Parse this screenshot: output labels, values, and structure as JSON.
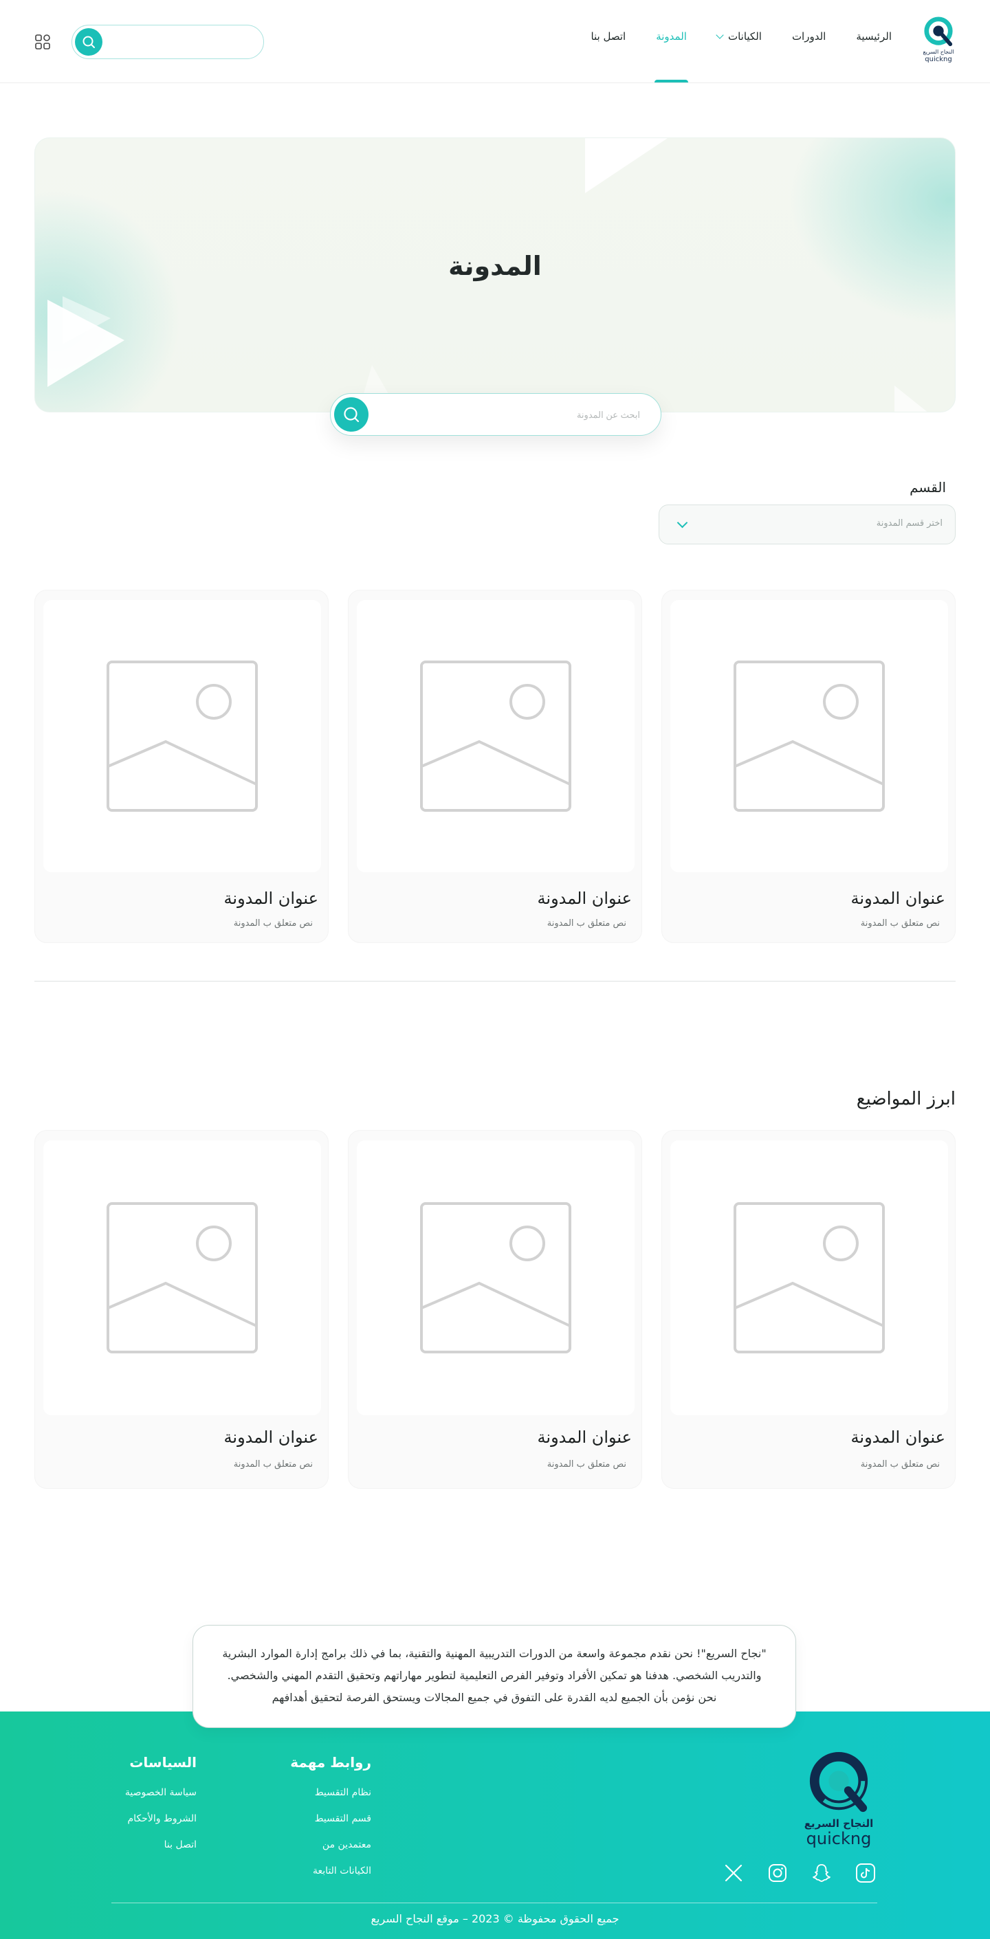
{
  "header": {
    "logo": {
      "ar": "النجاح السريع",
      "en": "quickng"
    },
    "nav": [
      {
        "label": "الرئيسية",
        "active": false,
        "dropdown": false
      },
      {
        "label": "الدورات",
        "active": false,
        "dropdown": false
      },
      {
        "label": "الكيانات",
        "active": false,
        "dropdown": true
      },
      {
        "label": "المدونة",
        "active": true,
        "dropdown": false
      },
      {
        "label": "اتصل بنا",
        "active": false,
        "dropdown": false
      }
    ],
    "search": {
      "placeholder": "",
      "value": ""
    }
  },
  "hero": {
    "title": "المدونة",
    "search_placeholder": "ابحث عن المدونة"
  },
  "filter": {
    "label": "القسم",
    "select_value": "اختر قسم المدونة"
  },
  "blog_cards": [
    {
      "title": "عنوان المدونة",
      "desc": "نص متعلق ب المدونة"
    },
    {
      "title": "عنوان المدونة",
      "desc": "نص متعلق ب المدونة"
    },
    {
      "title": "عنوان المدونة",
      "desc": "نص متعلق ب المدونة"
    }
  ],
  "top_topics": {
    "title": "ابرز المواضيع",
    "cards": [
      {
        "title": "عنوان المدونة",
        "desc": "نص متعلق ب المدونة"
      },
      {
        "title": "عنوان المدونة",
        "desc": "نص متعلق ب المدونة"
      },
      {
        "title": "عنوان المدونة",
        "desc": "نص متعلق ب المدونة"
      }
    ]
  },
  "about_quote": "\"نجاح السريع\"! نحن نقدم مجموعة واسعة من الدورات التدريبية المهنية والتقنية، بما في ذلك برامج إدارة الموارد البشرية والتدريب الشخصي. هدفنا هو تمكين الأفراد وتوفير الفرص التعليمية لتطوير مهاراتهم وتحقيق التقدم المهني والشخصي. نحن نؤمن بأن الجميع لديه القدرة على التفوق في جميع المجالات ويستحق الفرصة لتحقيق أهدافهم",
  "footer": {
    "logo": {
      "ar": "النجاح السريع",
      "en": "quickng"
    },
    "links": {
      "title": "روابط مهمة",
      "items": [
        "نظام التقسيط",
        "قسم التقسيط",
        "معتمدين من",
        "الكيانات التابعة"
      ]
    },
    "policies": {
      "title": "السياسات",
      "items": [
        "سياسة الخصوصية",
        "الشروط والأحكام",
        "اتصل بنا"
      ]
    },
    "socials": [
      "x-icon",
      "instagram-icon",
      "snapchat-icon",
      "tiktok-icon"
    ],
    "copyright": "جميع الحقوق محفوظة © 2023 – موقع النجاح السريع"
  },
  "colors": {
    "accent": "#1bbfb7",
    "footer_start": "#17c89c",
    "footer_end": "#12c8c9",
    "logo_dark": "#0f2b4d"
  }
}
